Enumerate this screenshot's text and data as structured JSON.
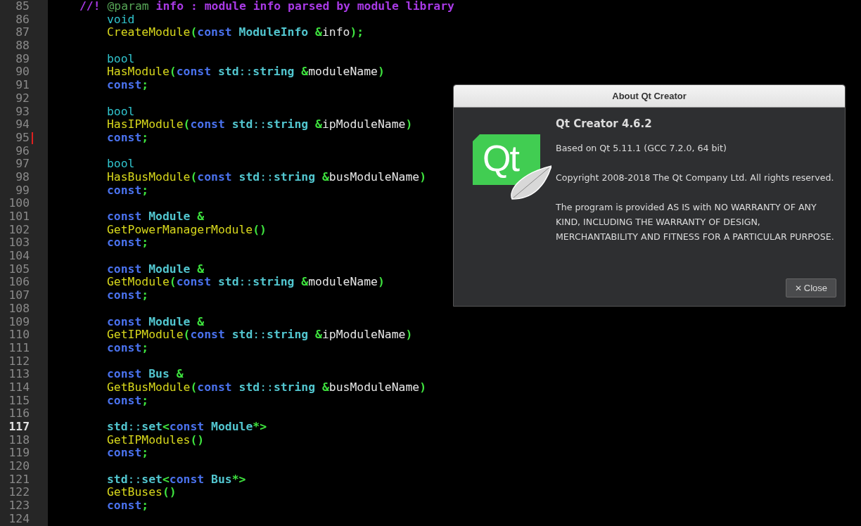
{
  "editor": {
    "lines": [
      {
        "number": "85",
        "kind": "doc",
        "tokens": [
          {
            "text": "//! ",
            "kind": "comment"
          },
          {
            "text": "@param",
            "kind": "tag"
          },
          {
            "text": " info : module info parsed by module library",
            "kind": "comment"
          }
        ]
      },
      {
        "number": "86",
        "kind": "code",
        "tokens": [
          {
            "text": "void",
            "kind": "prim"
          }
        ]
      },
      {
        "number": "87",
        "kind": "code",
        "tokens": [
          {
            "text": "CreateModule",
            "kind": "func"
          },
          {
            "text": "(",
            "kind": "punct"
          },
          {
            "text": "const ",
            "kind": "kw"
          },
          {
            "text": "ModuleInfo ",
            "kind": "type"
          },
          {
            "text": "&",
            "kind": "punct"
          },
          {
            "text": "info",
            "kind": "ident"
          },
          {
            "text": ");",
            "kind": "punct"
          }
        ]
      },
      {
        "number": "88",
        "kind": "code"
      },
      {
        "number": "89",
        "kind": "code",
        "tokens": [
          {
            "text": "bool",
            "kind": "prim"
          }
        ]
      },
      {
        "number": "90",
        "kind": "code",
        "tokens": [
          {
            "text": "HasModule",
            "kind": "func"
          },
          {
            "text": "(",
            "kind": "punct"
          },
          {
            "text": "const ",
            "kind": "kw"
          },
          {
            "text": "std",
            "kind": "type"
          },
          {
            "text": "::",
            "kind": "scope"
          },
          {
            "text": "string ",
            "kind": "type"
          },
          {
            "text": "&",
            "kind": "punct"
          },
          {
            "text": "moduleName",
            "kind": "ident"
          },
          {
            "text": ")",
            "kind": "punct"
          }
        ]
      },
      {
        "number": "91",
        "kind": "code",
        "tokens": [
          {
            "text": "const",
            "kind": "kw"
          },
          {
            "text": ";",
            "kind": "punct"
          }
        ]
      },
      {
        "number": "92",
        "kind": "code"
      },
      {
        "number": "93",
        "kind": "code",
        "tokens": [
          {
            "text": "bool",
            "kind": "prim"
          }
        ]
      },
      {
        "number": "94",
        "kind": "code",
        "tokens": [
          {
            "text": "HasIPModule",
            "kind": "func"
          },
          {
            "text": "(",
            "kind": "punct"
          },
          {
            "text": "const ",
            "kind": "kw"
          },
          {
            "text": "std",
            "kind": "type"
          },
          {
            "text": "::",
            "kind": "scope"
          },
          {
            "text": "string ",
            "kind": "type"
          },
          {
            "text": "&",
            "kind": "punct"
          },
          {
            "text": "ipModuleName",
            "kind": "ident"
          },
          {
            "text": ")",
            "kind": "punct"
          }
        ]
      },
      {
        "number": "95",
        "kind": "code",
        "modified": true,
        "tokens": [
          {
            "text": "const",
            "kind": "kw"
          },
          {
            "text": ";",
            "kind": "punct"
          }
        ]
      },
      {
        "number": "96",
        "kind": "code"
      },
      {
        "number": "97",
        "kind": "code",
        "tokens": [
          {
            "text": "bool",
            "kind": "prim"
          }
        ]
      },
      {
        "number": "98",
        "kind": "code",
        "tokens": [
          {
            "text": "HasBusModule",
            "kind": "func"
          },
          {
            "text": "(",
            "kind": "punct"
          },
          {
            "text": "const ",
            "kind": "kw"
          },
          {
            "text": "std",
            "kind": "type"
          },
          {
            "text": "::",
            "kind": "scope"
          },
          {
            "text": "string ",
            "kind": "type"
          },
          {
            "text": "&",
            "kind": "punct"
          },
          {
            "text": "busModuleName",
            "kind": "ident"
          },
          {
            "text": ")",
            "kind": "punct"
          }
        ]
      },
      {
        "number": "99",
        "kind": "code",
        "tokens": [
          {
            "text": "const",
            "kind": "kw"
          },
          {
            "text": ";",
            "kind": "punct"
          }
        ]
      },
      {
        "number": "100",
        "kind": "code"
      },
      {
        "number": "101",
        "kind": "code",
        "tokens": [
          {
            "text": "const ",
            "kind": "kw"
          },
          {
            "text": "Module ",
            "kind": "type"
          },
          {
            "text": "&",
            "kind": "punct"
          }
        ]
      },
      {
        "number": "102",
        "kind": "code",
        "tokens": [
          {
            "text": "GetPowerManagerModule",
            "kind": "func"
          },
          {
            "text": "()",
            "kind": "punct"
          }
        ]
      },
      {
        "number": "103",
        "kind": "code",
        "tokens": [
          {
            "text": "const",
            "kind": "kw"
          },
          {
            "text": ";",
            "kind": "punct"
          }
        ]
      },
      {
        "number": "104",
        "kind": "code"
      },
      {
        "number": "105",
        "kind": "code",
        "tokens": [
          {
            "text": "const ",
            "kind": "kw"
          },
          {
            "text": "Module ",
            "kind": "type"
          },
          {
            "text": "&",
            "kind": "punct"
          }
        ]
      },
      {
        "number": "106",
        "kind": "code",
        "tokens": [
          {
            "text": "GetModule",
            "kind": "func"
          },
          {
            "text": "(",
            "kind": "punct"
          },
          {
            "text": "const ",
            "kind": "kw"
          },
          {
            "text": "std",
            "kind": "type"
          },
          {
            "text": "::",
            "kind": "scope"
          },
          {
            "text": "string ",
            "kind": "type"
          },
          {
            "text": "&",
            "kind": "punct"
          },
          {
            "text": "moduleName",
            "kind": "ident"
          },
          {
            "text": ")",
            "kind": "punct"
          }
        ]
      },
      {
        "number": "107",
        "kind": "code",
        "tokens": [
          {
            "text": "const",
            "kind": "kw"
          },
          {
            "text": ";",
            "kind": "punct"
          }
        ]
      },
      {
        "number": "108",
        "kind": "code"
      },
      {
        "number": "109",
        "kind": "code",
        "tokens": [
          {
            "text": "const ",
            "kind": "kw"
          },
          {
            "text": "Module ",
            "kind": "type"
          },
          {
            "text": "&",
            "kind": "punct"
          }
        ]
      },
      {
        "number": "110",
        "kind": "code",
        "tokens": [
          {
            "text": "GetIPModule",
            "kind": "func"
          },
          {
            "text": "(",
            "kind": "punct"
          },
          {
            "text": "const ",
            "kind": "kw"
          },
          {
            "text": "std",
            "kind": "type"
          },
          {
            "text": "::",
            "kind": "scope"
          },
          {
            "text": "string ",
            "kind": "type"
          },
          {
            "text": "&",
            "kind": "punct"
          },
          {
            "text": "ipModuleName",
            "kind": "ident"
          },
          {
            "text": ")",
            "kind": "punct"
          }
        ]
      },
      {
        "number": "111",
        "kind": "code",
        "tokens": [
          {
            "text": "const",
            "kind": "kw"
          },
          {
            "text": ";",
            "kind": "punct"
          }
        ]
      },
      {
        "number": "112",
        "kind": "code"
      },
      {
        "number": "113",
        "kind": "code",
        "tokens": [
          {
            "text": "const ",
            "kind": "kw"
          },
          {
            "text": "Bus ",
            "kind": "type"
          },
          {
            "text": "&",
            "kind": "punct"
          }
        ]
      },
      {
        "number": "114",
        "kind": "code",
        "tokens": [
          {
            "text": "GetBusModule",
            "kind": "func"
          },
          {
            "text": "(",
            "kind": "punct"
          },
          {
            "text": "const ",
            "kind": "kw"
          },
          {
            "text": "std",
            "kind": "type"
          },
          {
            "text": "::",
            "kind": "scope"
          },
          {
            "text": "string ",
            "kind": "type"
          },
          {
            "text": "&",
            "kind": "punct"
          },
          {
            "text": "busModuleName",
            "kind": "ident"
          },
          {
            "text": ")",
            "kind": "punct"
          }
        ]
      },
      {
        "number": "115",
        "kind": "code",
        "tokens": [
          {
            "text": "const",
            "kind": "kw"
          },
          {
            "text": ";",
            "kind": "punct"
          }
        ]
      },
      {
        "number": "116",
        "kind": "code"
      },
      {
        "number": "117",
        "kind": "code",
        "current": true,
        "tokens": [
          {
            "text": "std",
            "kind": "type"
          },
          {
            "text": "::",
            "kind": "scope"
          },
          {
            "text": "set",
            "kind": "type"
          },
          {
            "text": "<",
            "kind": "punct"
          },
          {
            "text": "const ",
            "kind": "kw"
          },
          {
            "text": "Module",
            "kind": "type"
          },
          {
            "text": "*>",
            "kind": "punct"
          }
        ]
      },
      {
        "number": "118",
        "kind": "code",
        "tokens": [
          {
            "text": "GetIPModules",
            "kind": "func"
          },
          {
            "text": "()",
            "kind": "punct"
          }
        ]
      },
      {
        "number": "119",
        "kind": "code",
        "tokens": [
          {
            "text": "const",
            "kind": "kw"
          },
          {
            "text": ";",
            "kind": "punct"
          }
        ]
      },
      {
        "number": "120",
        "kind": "code"
      },
      {
        "number": "121",
        "kind": "code",
        "tokens": [
          {
            "text": "std",
            "kind": "type"
          },
          {
            "text": "::",
            "kind": "scope"
          },
          {
            "text": "set",
            "kind": "type"
          },
          {
            "text": "<",
            "kind": "punct"
          },
          {
            "text": "const ",
            "kind": "kw"
          },
          {
            "text": "Bus",
            "kind": "type"
          },
          {
            "text": "*>",
            "kind": "punct"
          }
        ]
      },
      {
        "number": "122",
        "kind": "code",
        "tokens": [
          {
            "text": "GetBuses",
            "kind": "func"
          },
          {
            "text": "()",
            "kind": "punct"
          }
        ]
      },
      {
        "number": "123",
        "kind": "code",
        "tokens": [
          {
            "text": "const",
            "kind": "kw"
          },
          {
            "text": ";",
            "kind": "punct"
          }
        ]
      },
      {
        "number": "124",
        "kind": "code"
      }
    ]
  },
  "dialog": {
    "title": "About Qt Creator",
    "logo_text": "Qt",
    "heading": "Qt Creator 4.6.2",
    "paragraphs": [
      "Based on Qt 5.11.1 (GCC 7.2.0, 64 bit)",
      "Copyright 2008-2018 The Qt Company Ltd. All rights reserved.",
      "The program is provided AS IS with NO WARRANTY OF ANY KIND, INCLUDING THE WARRANTY OF DESIGN, MERCHANTABILITY AND FITNESS FOR A PARTICULAR PURPOSE."
    ],
    "close_button": {
      "icon": "✕",
      "label": "Close"
    }
  }
}
